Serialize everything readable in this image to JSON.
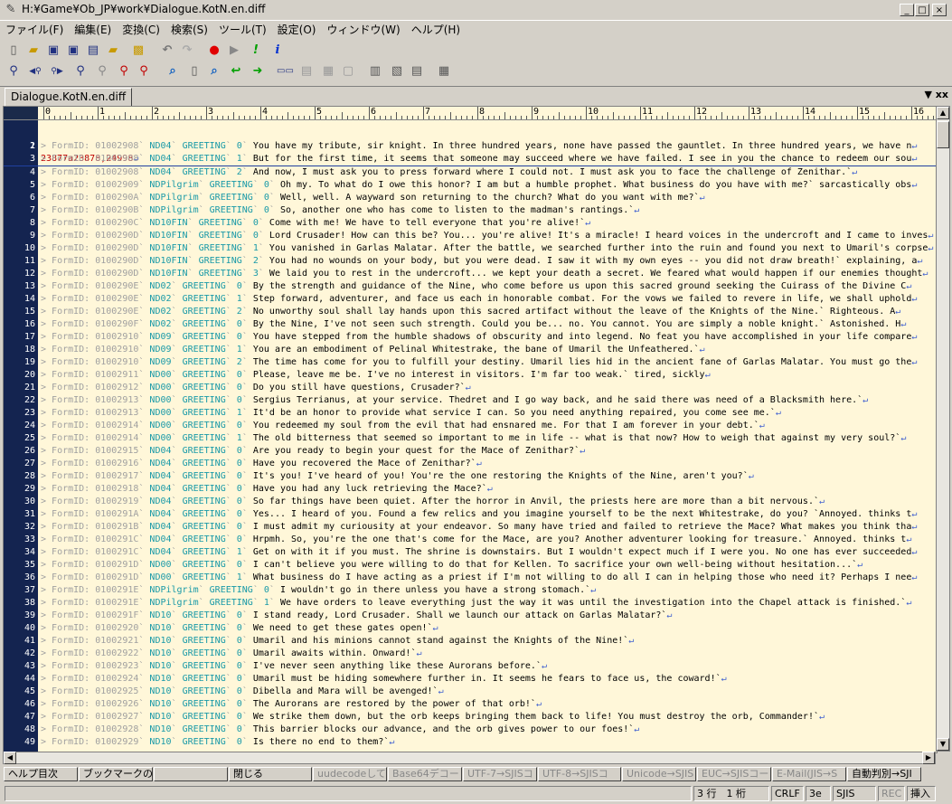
{
  "window": {
    "title": "H:¥Game¥Ob_JP¥work¥Dialogue.KotN.en.diff",
    "min": "_",
    "max": "□",
    "close": "×"
  },
  "menu": [
    "ファイル(F)",
    "編集(E)",
    "変換(C)",
    "検索(S)",
    "ツール(T)",
    "設定(O)",
    "ウィンドウ(W)",
    "ヘルプ(H)"
  ],
  "tab": {
    "label": "Dialogue.KotN.en.diff",
    "close": "xx"
  },
  "ruler": [
    "0",
    "1",
    "2",
    "3",
    "4",
    "5",
    "6",
    "7",
    "8",
    "9",
    "10",
    "11",
    "12",
    "13",
    "14",
    "15",
    "16"
  ],
  "header_line": {
    "num": "1",
    "a": "23877a23878,24998",
    "ret": "↵"
  },
  "lines": [
    [
      "2",
      "FormID: 01002908",
      "ND04",
      "GREETING",
      "0",
      "You have my tribute, sir knight. In three hundred years, none have passed the gauntlet. In three hundred years, we have n"
    ],
    [
      "3",
      "FormID: 01002908",
      "ND04",
      "GREETING",
      "1",
      "But for the first time, it seems that someone may succeed where we have failed. I see in you the chance to redeem our sou"
    ],
    [
      "4",
      "FormID: 01002908",
      "ND04",
      "GREETING",
      "2",
      "And now, I must ask you to press forward where I could not. I must ask you to face the challenge of Zenithar.`"
    ],
    [
      "5",
      "FormID: 01002909",
      "NDPilgrim",
      "GREETING",
      "0",
      "Oh my. To what do I owe this honor? I am but a humble prophet. What business do you have with me?` sarcastically obs"
    ],
    [
      "6",
      "FormID: 0100290A",
      "NDPilgrim",
      "GREETING",
      "0",
      "Well, well. A wayward son returning to the church? What do you want with me?`"
    ],
    [
      "7",
      "FormID: 0100290B",
      "NDPilgrim",
      "GREETING",
      "0",
      "So, another one who has come to listen to the madman's rantings.`"
    ],
    [
      "8",
      "FormID: 0100290C",
      "ND10FIN",
      "GREETING",
      "0",
      "Come with me! We have to tell everyone that you're alive!`"
    ],
    [
      "9",
      "FormID: 0100290D",
      "ND10FIN",
      "GREETING",
      "0",
      "Lord Crusader! How can this be? You... you're alive! It's a miracle! I heard voices in the undercroft and I came to inves"
    ],
    [
      "10",
      "FormID: 0100290D",
      "ND10FIN",
      "GREETING",
      "1",
      "You vanished in Garlas Malatar. After the battle, we searched further into the ruin and found you next to Umaril's corpse"
    ],
    [
      "11",
      "FormID: 0100290D",
      "ND10FIN",
      "GREETING",
      "2",
      "You had no wounds on your body, but you were dead. I saw it with my own eyes -- you did not draw breath!` explaining, a"
    ],
    [
      "12",
      "FormID: 0100290D",
      "ND10FIN",
      "GREETING",
      "3",
      "We laid you to rest in the undercroft... we kept your death a secret. We feared what would happen if our enemies thought"
    ],
    [
      "13",
      "FormID: 0100290E",
      "ND02",
      "GREETING",
      "0",
      "By the strength and guidance of the Nine, who come before us upon this sacred ground seeking the Cuirass of the Divine C"
    ],
    [
      "14",
      "FormID: 0100290E",
      "ND02",
      "GREETING",
      "1",
      "Step forward, adventurer, and face us each in honorable combat. For the vows we failed to revere in life, we shall uphold"
    ],
    [
      "15",
      "FormID: 0100290E",
      "ND02",
      "GREETING",
      "2",
      "No unworthy soul shall lay hands upon this sacred artifact without the leave of the Knights of the Nine.` Righteous. A"
    ],
    [
      "16",
      "FormID: 0100290F",
      "ND02",
      "GREETING",
      "0",
      "By the Nine, I've not seen such strength. Could you be... no. You cannot. You are simply a noble knight.` Astonished. H"
    ],
    [
      "17",
      "FormID: 01002910",
      "ND09",
      "GREETING",
      "0",
      "You have stepped from the humble shadows of obscurity and into legend. No feat you have accomplished in your life compare"
    ],
    [
      "18",
      "FormID: 01002910",
      "ND09",
      "GREETING",
      "1",
      "You are an embodiment of Pelinal Whitestrake, the bane of Umaril the Unfeathered.`"
    ],
    [
      "19",
      "FormID: 01002910",
      "ND09",
      "GREETING",
      "2",
      "The time has come for you to fulfill your destiny. Umaril lies hid in the ancient fane of Garlas Malatar. You must go the"
    ],
    [
      "20",
      "FormID: 01002911",
      "ND00",
      "GREETING",
      "0",
      "Please, leave me be. I've no interest in visitors. I'm far too weak.` tired, sickly"
    ],
    [
      "21",
      "FormID: 01002912",
      "ND00",
      "GREETING",
      "0",
      "Do you still have questions, Crusader?`"
    ],
    [
      "22",
      "FormID: 01002913",
      "ND00",
      "GREETING",
      "0",
      "Sergius Terrianus, at your service. Thedret and I go way back, and he said there was need of a Blacksmith here.`"
    ],
    [
      "23",
      "FormID: 01002913",
      "ND00",
      "GREETING",
      "1",
      "It'd be an honor to provide what service I can. So you need anything repaired, you come see me.`"
    ],
    [
      "24",
      "FormID: 01002914",
      "ND00",
      "GREETING",
      "0",
      "You redeemed my soul from the evil that had ensnared me. For that I am forever in your debt.`"
    ],
    [
      "25",
      "FormID: 01002914",
      "ND00",
      "GREETING",
      "1",
      "The old bitterness that seemed so important to me in life -- what is that now? How to weigh that against my very soul?`"
    ],
    [
      "26",
      "FormID: 01002915",
      "ND04",
      "GREETING",
      "0",
      "Are you ready to begin your quest for the Mace of Zenithar?`"
    ],
    [
      "27",
      "FormID: 01002916",
      "ND04",
      "GREETING",
      "0",
      "Have you recovered the Mace of Zenithar?`"
    ],
    [
      "28",
      "FormID: 01002917",
      "ND04",
      "GREETING",
      "0",
      "It's you! I've heard of you! You're the one restoring the Knights of the Nine, aren't you?`"
    ],
    [
      "29",
      "FormID: 01002918",
      "ND04",
      "GREETING",
      "0",
      "Have you had any luck retrieving the Mace?`"
    ],
    [
      "30",
      "FormID: 01002919",
      "ND04",
      "GREETING",
      "0",
      "So far things have been quiet. After the horror in Anvil, the priests here are more than a bit nervous.`"
    ],
    [
      "31",
      "FormID: 0100291A",
      "ND04",
      "GREETING",
      "0",
      "Yes... I heard of you. Found a few relics and you imagine yourself to be the next Whitestrake, do you? `Annoyed. thinks t"
    ],
    [
      "32",
      "FormID: 0100291B",
      "ND04",
      "GREETING",
      "0",
      "I must admit my curiousity at your endeavor. So many have tried and failed to retrieve the Mace? What makes you think tha"
    ],
    [
      "33",
      "FormID: 0100291C",
      "ND04",
      "GREETING",
      "0",
      "Hrpmh. So, you're the one that's come for the Mace, are you? Another adventurer looking for treasure.` Annoyed. thinks t"
    ],
    [
      "34",
      "FormID: 0100291C",
      "ND04",
      "GREETING",
      "1",
      "Get on with it if you must. The shrine is downstairs. But I wouldn't expect much if I were you. No one has ever succeeded"
    ],
    [
      "35",
      "FormID: 0100291D",
      "ND00",
      "GREETING",
      "0",
      "I can't believe you were willing to do that for Kellen. To sacrifice your own well-being without hesitation...`"
    ],
    [
      "36",
      "FormID: 0100291D",
      "ND00",
      "GREETING",
      "1",
      "What business do I have acting as a priest if I'm not willing to do all I can in helping those who need it? Perhaps I nee"
    ],
    [
      "37",
      "FormID: 0100291E",
      "NDPilgrim",
      "GREETING",
      "0",
      "I wouldn't go in there unless you have a strong stomach.`"
    ],
    [
      "38",
      "FormID: 0100291E",
      "NDPilgrim",
      "GREETING",
      "1",
      "We have orders to leave everything just the way it was until the investigation into the Chapel attack is finished.`"
    ],
    [
      "39",
      "FormID: 0100291F",
      "ND10",
      "GREETING",
      "0",
      "I stand ready, Lord Crusader. Shall we launch our attack on Garlas Malatar?`"
    ],
    [
      "40",
      "FormID: 01002920",
      "ND10",
      "GREETING",
      "0",
      "We need to get these gates open!`"
    ],
    [
      "41",
      "FormID: 01002921",
      "ND10",
      "GREETING",
      "0",
      "Umaril and his minions cannot stand against the Knights of the Nine!`"
    ],
    [
      "42",
      "FormID: 01002922",
      "ND10",
      "GREETING",
      "0",
      "Umaril awaits within. Onward!`"
    ],
    [
      "43",
      "FormID: 01002923",
      "ND10",
      "GREETING",
      "0",
      "I've never seen anything like these Aurorans before.`"
    ],
    [
      "44",
      "FormID: 01002924",
      "ND10",
      "GREETING",
      "0",
      "Umaril must be hiding somewhere further in. It seems he fears to face us, the coward!`"
    ],
    [
      "45",
      "FormID: 01002925",
      "ND10",
      "GREETING",
      "0",
      "Dibella and Mara will be avenged!`"
    ],
    [
      "46",
      "FormID: 01002926",
      "ND10",
      "GREETING",
      "0",
      "The Aurorans are restored by the power of that orb!`"
    ],
    [
      "47",
      "FormID: 01002927",
      "ND10",
      "GREETING",
      "0",
      "We strike them down, but the orb keeps bringing them back to life! You must destroy the orb, Commander!`"
    ],
    [
      "48",
      "FormID: 01002928",
      "ND10",
      "GREETING",
      "0",
      "This barrier blocks our advance, and the orb gives power to our foes!`"
    ],
    [
      "49",
      "FormID: 01002929",
      "ND10",
      "GREETING",
      "0",
      "Is there no end to them?`"
    ]
  ],
  "fkeys": [
    {
      "label": "ヘルプ目次",
      "dis": false,
      "w": 84
    },
    {
      "label": "ブックマークの",
      "dis": false,
      "w": 84
    },
    {
      "label": "",
      "dis": false,
      "w": 84
    },
    {
      "label": "閉じる",
      "dis": false,
      "w": 94
    },
    {
      "label": "uudecodeして保",
      "dis": true,
      "w": 84
    },
    {
      "label": "Base64デコード",
      "dis": true,
      "w": 84
    },
    {
      "label": "UTF-7→SJISコ",
      "dis": true,
      "w": 84
    },
    {
      "label": "UTF-8→SJISコ",
      "dis": true,
      "w": 94
    },
    {
      "label": "Unicode→SJIS",
      "dis": true,
      "w": 84
    },
    {
      "label": "EUC→SJISコー",
      "dis": true,
      "w": 84
    },
    {
      "label": "E-Mail(JIS→S",
      "dis": true,
      "w": 84
    },
    {
      "label": "自動判別→SJI",
      "dis": false,
      "w": 84
    }
  ],
  "status": {
    "pos": "3 行　1 桁",
    "crlf": "CRLF",
    "code": "3e",
    "enc": "SJIS",
    "rec": "REC",
    "ins": "挿入"
  }
}
